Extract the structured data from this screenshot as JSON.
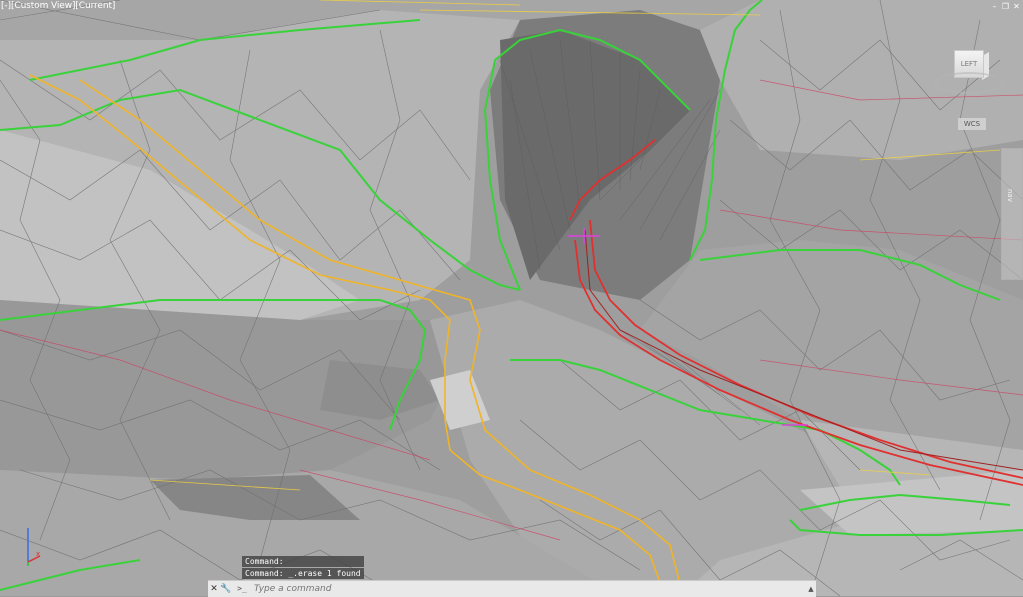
{
  "viewport": {
    "label": "[-][Custom View][Current]",
    "controls": {
      "minimize": "–",
      "restore": "❐",
      "close": "✕"
    },
    "background": "#9c9c9c",
    "line_colors": {
      "daylight_green": "#39d23a",
      "alignment_red": "#e03030",
      "road_yellow": "#f0b428",
      "marker_magenta": "#e040e0",
      "mesh_edge": "#6e6e6e"
    }
  },
  "viewcube": {
    "face_label": "LEFT",
    "ucs_label": "WCS"
  },
  "navbar": {
    "label": "nav"
  },
  "command": {
    "history": [
      "Command:",
      "Command: _.erase 1 found"
    ],
    "placeholder": "Type a command",
    "prompt_icon": ">_",
    "close_icon": "✕",
    "settings_icon": "🔧"
  },
  "ucs_icon": {
    "axes": [
      "x",
      "y",
      "z"
    ]
  }
}
